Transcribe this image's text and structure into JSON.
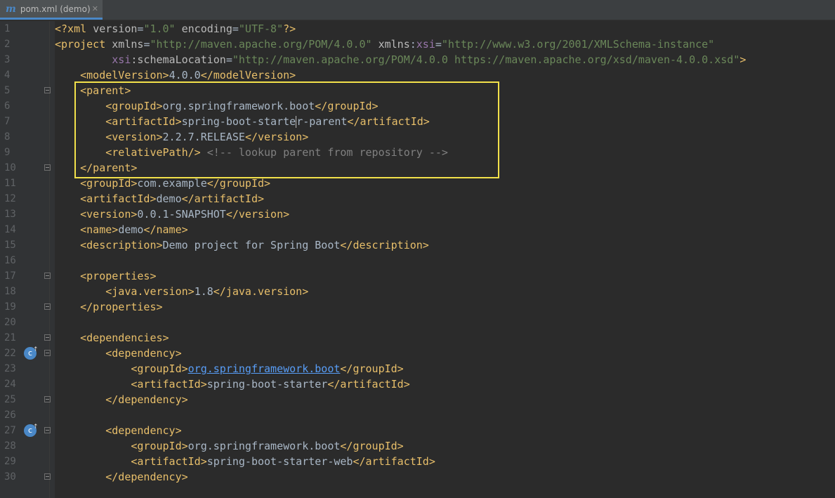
{
  "tab": {
    "icon": "maven-m-icon",
    "title": "pom.xml (demo)",
    "close": "✕"
  },
  "lines": [
    {
      "n": "1",
      "parts": [
        {
          "c": "tag",
          "t": "<?xml "
        },
        {
          "c": "attr",
          "t": "version"
        },
        {
          "c": "txt",
          "t": "="
        },
        {
          "c": "val",
          "t": "\"1.0\""
        },
        {
          "c": "attr",
          "t": " encoding"
        },
        {
          "c": "txt",
          "t": "="
        },
        {
          "c": "val",
          "t": "\"UTF-8\""
        },
        {
          "c": "tag",
          "t": "?>"
        }
      ]
    },
    {
      "n": "2",
      "parts": [
        {
          "c": "tag",
          "t": "<project "
        },
        {
          "c": "attr",
          "t": "xmlns"
        },
        {
          "c": "txt",
          "t": "="
        },
        {
          "c": "val",
          "t": "\"http://maven.apache.org/POM/4.0.0\""
        },
        {
          "c": "attr",
          "t": " xmlns"
        },
        {
          "c": "txt",
          "t": ":"
        },
        {
          "c": "ns",
          "t": "xsi"
        },
        {
          "c": "txt",
          "t": "="
        },
        {
          "c": "val",
          "t": "\"http://www.w3.org/2001/XMLSchema-instance\""
        }
      ]
    },
    {
      "n": "3",
      "parts": [
        {
          "c": "txt",
          "t": "         "
        },
        {
          "c": "ns",
          "t": "xsi"
        },
        {
          "c": "attr",
          "t": ":schemaLocation"
        },
        {
          "c": "txt",
          "t": "="
        },
        {
          "c": "val",
          "t": "\"http://maven.apache.org/POM/4.0.0 https://maven.apache.org/xsd/maven-4.0.0.xsd\""
        },
        {
          "c": "tag",
          "t": ">"
        }
      ]
    },
    {
      "n": "4",
      "parts": [
        {
          "c": "txt",
          "t": "    "
        },
        {
          "c": "tag",
          "t": "<modelVersion>"
        },
        {
          "c": "txt",
          "t": "4.0.0"
        },
        {
          "c": "tag",
          "t": "</modelVersion>"
        }
      ]
    },
    {
      "n": "5",
      "fold": true,
      "parts": [
        {
          "c": "txt",
          "t": "    "
        },
        {
          "c": "tag",
          "t": "<parent>"
        }
      ]
    },
    {
      "n": "6",
      "parts": [
        {
          "c": "txt",
          "t": "        "
        },
        {
          "c": "tag",
          "t": "<groupId>"
        },
        {
          "c": "txt",
          "t": "org.springframework.boot"
        },
        {
          "c": "tag",
          "t": "</groupId>"
        }
      ]
    },
    {
      "n": "7",
      "caret": true,
      "parts": [
        {
          "c": "txt",
          "t": "        "
        },
        {
          "c": "tag",
          "t": "<artifactId>"
        },
        {
          "c": "txt",
          "t": "spring-boot-starte"
        },
        {
          "c": "caret",
          "t": ""
        },
        {
          "c": "txt",
          "t": "r-parent"
        },
        {
          "c": "tag",
          "t": "</artifactId>"
        }
      ]
    },
    {
      "n": "8",
      "parts": [
        {
          "c": "txt",
          "t": "        "
        },
        {
          "c": "tag",
          "t": "<version>"
        },
        {
          "c": "txt",
          "t": "2.2.7.RELEASE"
        },
        {
          "c": "tag",
          "t": "</version>"
        }
      ]
    },
    {
      "n": "9",
      "parts": [
        {
          "c": "txt",
          "t": "        "
        },
        {
          "c": "tag",
          "t": "<relativePath/>"
        },
        {
          "c": "txt",
          "t": " "
        },
        {
          "c": "cmt",
          "t": "<!-- lookup parent from repository -->"
        }
      ]
    },
    {
      "n": "10",
      "fold": true,
      "parts": [
        {
          "c": "txt",
          "t": "    "
        },
        {
          "c": "tag",
          "t": "</parent>"
        }
      ]
    },
    {
      "n": "11",
      "parts": [
        {
          "c": "txt",
          "t": "    "
        },
        {
          "c": "tag",
          "t": "<groupId>"
        },
        {
          "c": "txt",
          "t": "com.example"
        },
        {
          "c": "tag",
          "t": "</groupId>"
        }
      ]
    },
    {
      "n": "12",
      "parts": [
        {
          "c": "txt",
          "t": "    "
        },
        {
          "c": "tag",
          "t": "<artifactId>"
        },
        {
          "c": "txt",
          "t": "demo"
        },
        {
          "c": "tag",
          "t": "</artifactId>"
        }
      ]
    },
    {
      "n": "13",
      "parts": [
        {
          "c": "txt",
          "t": "    "
        },
        {
          "c": "tag",
          "t": "<version>"
        },
        {
          "c": "txt",
          "t": "0.0.1-SNAPSHOT"
        },
        {
          "c": "tag",
          "t": "</version>"
        }
      ]
    },
    {
      "n": "14",
      "parts": [
        {
          "c": "txt",
          "t": "    "
        },
        {
          "c": "tag",
          "t": "<name>"
        },
        {
          "c": "txt",
          "t": "demo"
        },
        {
          "c": "tag",
          "t": "</name>"
        }
      ]
    },
    {
      "n": "15",
      "parts": [
        {
          "c": "txt",
          "t": "    "
        },
        {
          "c": "tag",
          "t": "<description>"
        },
        {
          "c": "txt",
          "t": "Demo project for Spring Boot"
        },
        {
          "c": "tag",
          "t": "</description>"
        }
      ]
    },
    {
      "n": "16",
      "parts": []
    },
    {
      "n": "17",
      "fold": true,
      "parts": [
        {
          "c": "txt",
          "t": "    "
        },
        {
          "c": "tag",
          "t": "<properties>"
        }
      ]
    },
    {
      "n": "18",
      "parts": [
        {
          "c": "txt",
          "t": "        "
        },
        {
          "c": "tag",
          "t": "<java.version>"
        },
        {
          "c": "txt",
          "t": "1.8"
        },
        {
          "c": "tag",
          "t": "</java.version>"
        }
      ]
    },
    {
      "n": "19",
      "fold": true,
      "parts": [
        {
          "c": "txt",
          "t": "    "
        },
        {
          "c": "tag",
          "t": "</properties>"
        }
      ]
    },
    {
      "n": "20",
      "parts": []
    },
    {
      "n": "21",
      "fold": true,
      "parts": [
        {
          "c": "txt",
          "t": "    "
        },
        {
          "c": "tag",
          "t": "<dependencies>"
        }
      ]
    },
    {
      "n": "22",
      "fold": true,
      "gicon": true,
      "parts": [
        {
          "c": "txt",
          "t": "        "
        },
        {
          "c": "tag",
          "t": "<dependency>"
        }
      ]
    },
    {
      "n": "23",
      "parts": [
        {
          "c": "txt",
          "t": "            "
        },
        {
          "c": "tag",
          "t": "<groupId>"
        },
        {
          "c": "link",
          "t": "org.springframework.boot"
        },
        {
          "c": "tag",
          "t": "</groupId>"
        }
      ]
    },
    {
      "n": "24",
      "parts": [
        {
          "c": "txt",
          "t": "            "
        },
        {
          "c": "tag",
          "t": "<artifactId>"
        },
        {
          "c": "txt",
          "t": "spring-boot-starter"
        },
        {
          "c": "tag",
          "t": "</artifactId>"
        }
      ]
    },
    {
      "n": "25",
      "fold": true,
      "parts": [
        {
          "c": "txt",
          "t": "        "
        },
        {
          "c": "tag",
          "t": "</dependency>"
        }
      ]
    },
    {
      "n": "26",
      "parts": []
    },
    {
      "n": "27",
      "fold": true,
      "gicon": true,
      "parts": [
        {
          "c": "txt",
          "t": "        "
        },
        {
          "c": "tag",
          "t": "<dependency>"
        }
      ]
    },
    {
      "n": "28",
      "parts": [
        {
          "c": "txt",
          "t": "            "
        },
        {
          "c": "tag",
          "t": "<groupId>"
        },
        {
          "c": "txt",
          "t": "org.springframework.boot"
        },
        {
          "c": "tag",
          "t": "</groupId>"
        }
      ]
    },
    {
      "n": "29",
      "parts": [
        {
          "c": "txt",
          "t": "            "
        },
        {
          "c": "tag",
          "t": "<artifactId>"
        },
        {
          "c": "txt",
          "t": "spring-boot-starter-web"
        },
        {
          "c": "tag",
          "t": "</artifactId>"
        }
      ]
    },
    {
      "n": "30",
      "fold": true,
      "parts": [
        {
          "c": "txt",
          "t": "        "
        },
        {
          "c": "tag",
          "t": "</dependency>"
        }
      ]
    }
  ],
  "colors": {
    "tag": "#e8bf6a",
    "attr": "#bababa",
    "value": "#6a8759",
    "comment": "#808080",
    "highlight_box": "#f2e14a"
  }
}
